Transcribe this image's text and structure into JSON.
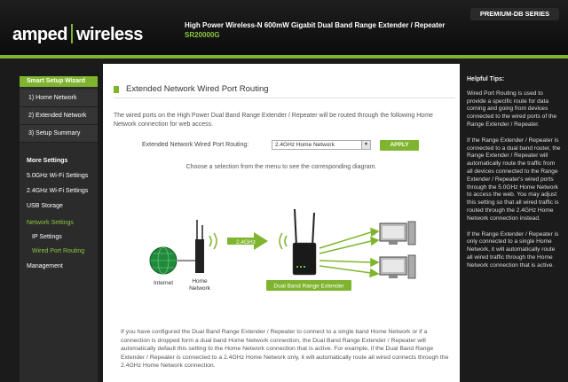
{
  "header": {
    "logo_left": "amped",
    "logo_right": "wireless",
    "product_title": "High Power Wireless-N 600mW Gigabit Dual Band Range Extender / Repeater",
    "model": "SR20000G",
    "series": "PREMIUM-DB SERIES"
  },
  "sidebar": {
    "wizard_heading": "Smart Setup Wizard",
    "wizard_items": [
      "1) Home Network",
      "2) Extended Network",
      "3) Setup Summary"
    ],
    "more_settings": "More Settings",
    "settings_links": [
      "5.0GHz Wi-Fi Settings",
      "2.4GHz Wi-Fi Settings",
      "USB Storage"
    ],
    "network_settings": "Network Settings",
    "network_sub": [
      "IP Settings",
      "Wired Port Routing"
    ],
    "management": "Management"
  },
  "main": {
    "title": "Extended Network Wired Port Routing",
    "intro": "The wired ports on the High Power Dual Band Range Extender / Repeater will be routed through the following Home Network connection for web access.",
    "routing_label": "Extended Network Wired Port Routing:",
    "routing_value": "2.4GHz Home Network",
    "apply_label": "APPLY",
    "hint": "Choose a selection from the menu to see the corresponding diagram.",
    "diagram": {
      "internet": "Internet",
      "home_network_line1": "Home",
      "home_network_line2": "Network",
      "band": "2.4GHz",
      "extender": "Dual Band Range Extender"
    },
    "bottom_text": "If you have configured the Dual Band Range Extender / Repeater to connect to a single band Home Network or if a connection is dropped form a dual band Home Network connection, the Dual Band Range Extender / Repeater will automatically default this setting to the Home Network connection that is active. For example, if the Dual Band Range Extender / Repeater is connected to a 2.4GHz Home Network only, it will automatically route all wired connects through the 2.4GHz Home Network connection."
  },
  "tips": {
    "title": "Helpful Tips:",
    "p1": "Wired Port Routing is used to provide a specific route for data coming and going from devices connected to the wired ports of the Range Extender / Repeater.",
    "p2": "If the Range Extender / Repeater is connected to a dual band router, the Range Extender / Repeater will automatically route the traffic from all devices connected to the Range Extender / Repeater's wired ports through the 5.0GHz Home Network to access the web. You may adjust this setting so that all wired traffic is routed through the 2.4GHz Home Network connection instead.",
    "p3": "If the Range Extender / Repeater is only connected to a single Home Network, it will automatically route all wired traffic through the Home Network connection that is active."
  },
  "colors": {
    "accent": "#7fb52e",
    "header_bg": "#111111",
    "panel_bg": "#ffffff"
  }
}
